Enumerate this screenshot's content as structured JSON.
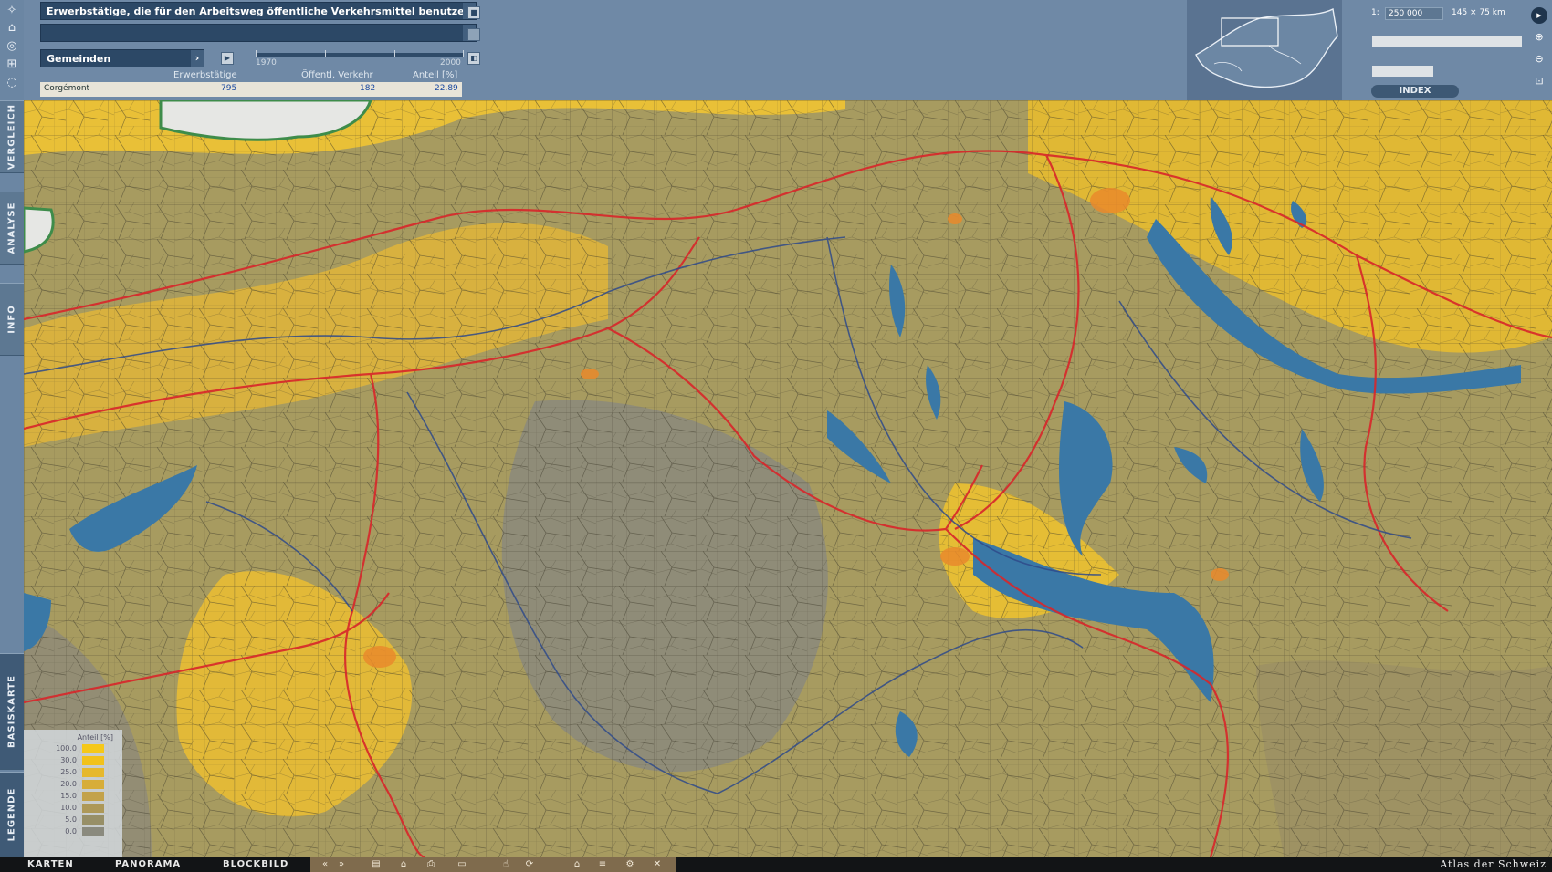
{
  "app": {
    "brand": "Atlas der Schweiz"
  },
  "rail": {
    "tabs": [
      "VERGLEICH",
      "ANALYSE",
      "INFO",
      "BASISKARTE",
      "LEGENDE"
    ]
  },
  "theme": {
    "title": "Erwerbstätige, die für den Arbeitsweg öffentliche Verkehrsmittel benutzen",
    "secondary": "",
    "level": "Gemeinden"
  },
  "timeline": {
    "start": "1970",
    "end": "2000"
  },
  "table": {
    "headers": [
      "Erwerbstätige",
      "Öffentl. Verkehr",
      "Anteil [%]"
    ],
    "row": {
      "name": "Corgémont",
      "erwerbstaetige": "795",
      "oeffentl": "182",
      "anteil": "22.89"
    }
  },
  "scale": {
    "prefix": "1:",
    "value": "250 000",
    "extent": "145 × 75 km",
    "index_label": "INDEX"
  },
  "legend": {
    "title": "Anteil [%]",
    "classes": [
      {
        "value": "100.0",
        "color": "#f5c818"
      },
      {
        "value": "30.0",
        "color": "#f2c21a"
      },
      {
        "value": "25.0",
        "color": "#e6b82c"
      },
      {
        "value": "20.0",
        "color": "#d7ad38"
      },
      {
        "value": "15.0",
        "color": "#c3a24a"
      },
      {
        "value": "10.0",
        "color": "#ad9857"
      },
      {
        "value": "5.0",
        "color": "#978f67"
      },
      {
        "value": "0.0",
        "color": "#8a8a7e"
      }
    ]
  },
  "bottom": {
    "tabs": [
      "KARTEN",
      "PANORAMA",
      "BLOCKBILD"
    ],
    "icons": [
      "rewind-icon",
      "forward-icon",
      "document-icon",
      "lock-icon",
      "print-icon",
      "export-icon",
      "pointer-icon",
      "rotate-icon",
      "home-icon",
      "list-icon",
      "settings-icon",
      "close-icon"
    ]
  },
  "colors": {
    "panel": "#6f89a6",
    "lake": "#3f7aa6",
    "rail_red": "#d8262a",
    "road_blue": "#2f4a8a"
  }
}
